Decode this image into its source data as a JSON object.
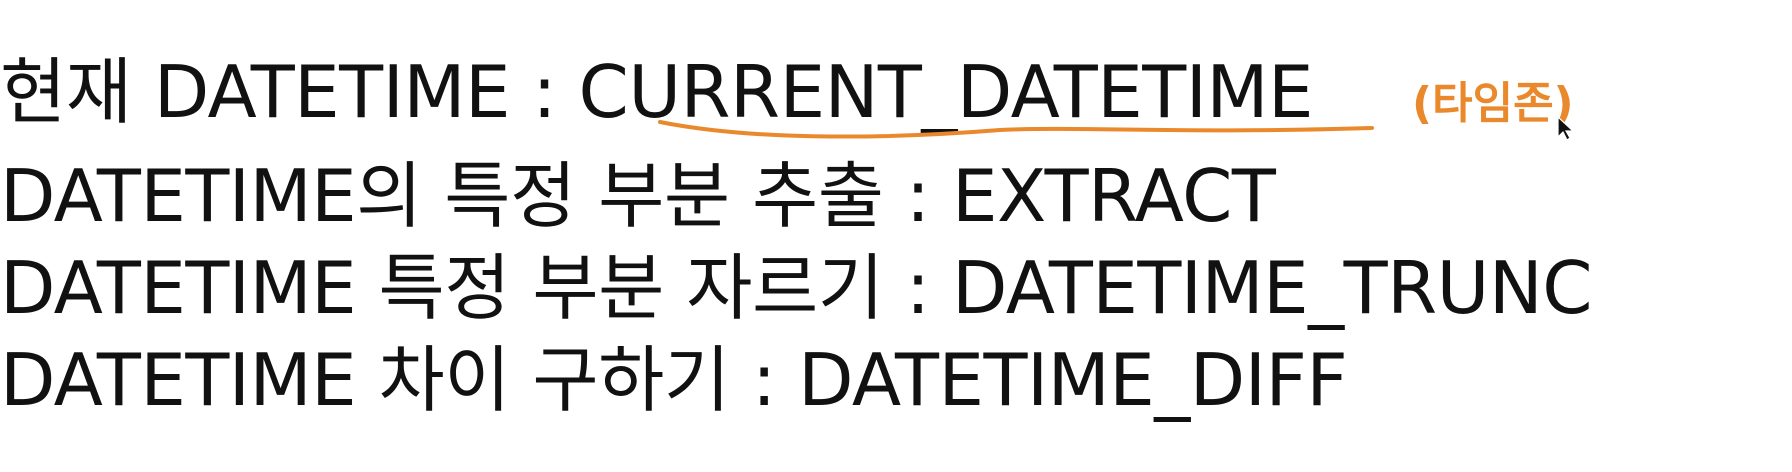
{
  "lines": [
    {
      "label": "현재 DATETIME",
      "separator": " : ",
      "value": "CURRENT_DATETIME"
    },
    {
      "label": "DATETIME의 특정 부분 추출",
      "separator": " : ",
      "value": "EXTRACT"
    },
    {
      "label": "DATETIME 특정 부분 자르기",
      "separator": " : ",
      "value": "DATETIME_TRUNC"
    },
    {
      "label": "DATETIME 차이 구하기",
      "separator": " : ",
      "value": "DATETIME_DIFF"
    }
  ],
  "annotation": {
    "text": "(타임존)",
    "color": "#e9892b",
    "underline_target": "CURRENT_DATETIME"
  },
  "cursor": {
    "icon": "mouse-pointer-icon"
  },
  "colors": {
    "text": "#111111",
    "background": "#ffffff",
    "annotation": "#e9892b"
  }
}
